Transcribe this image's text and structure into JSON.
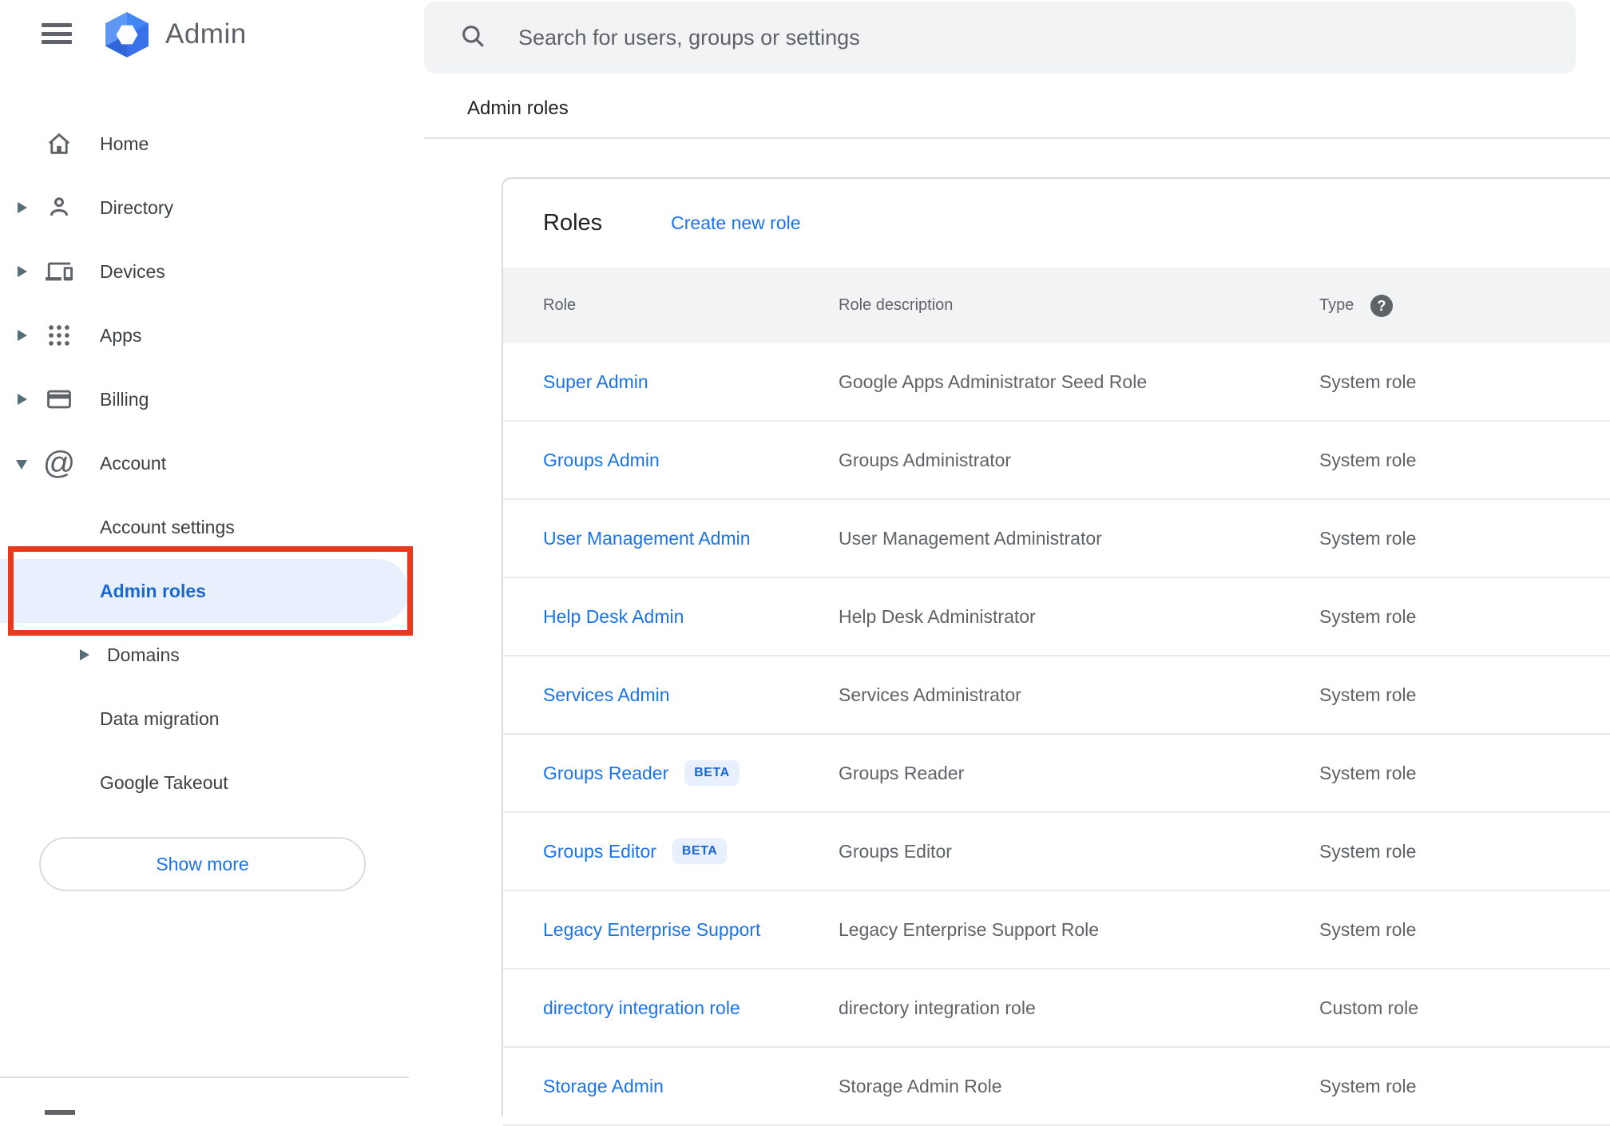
{
  "app": {
    "title": "Admin"
  },
  "search": {
    "placeholder": "Search for users, groups or settings"
  },
  "breadcrumb": "Admin roles",
  "sidebar": {
    "items": [
      {
        "label": "Home",
        "icon": "home-icon",
        "expandable": false
      },
      {
        "label": "Directory",
        "icon": "person-icon",
        "expandable": true
      },
      {
        "label": "Devices",
        "icon": "devices-icon",
        "expandable": true
      },
      {
        "label": "Apps",
        "icon": "apps-grid-icon",
        "expandable": true
      },
      {
        "label": "Billing",
        "icon": "credit-card-icon",
        "expandable": true
      },
      {
        "label": "Account",
        "icon": "at-sign-icon",
        "expandable": true,
        "expanded": true
      }
    ],
    "account_children": [
      {
        "label": "Account settings"
      },
      {
        "label": "Admin roles",
        "selected": true,
        "annotated": true
      },
      {
        "label": "Domains",
        "expandable": true
      },
      {
        "label": "Data migration"
      },
      {
        "label": "Google Takeout"
      }
    ],
    "show_more_label": "Show more"
  },
  "main": {
    "card_title": "Roles",
    "create_link": "Create new role",
    "table": {
      "columns": [
        "Role",
        "Role description",
        "Type"
      ],
      "help_icon": "?",
      "rows": [
        {
          "role": "Super Admin",
          "description": "Google Apps Administrator Seed Role",
          "type": "System role"
        },
        {
          "role": "Groups Admin",
          "description": "Groups Administrator",
          "type": "System role"
        },
        {
          "role": "User Management Admin",
          "description": "User Management Administrator",
          "type": "System role"
        },
        {
          "role": "Help Desk Admin",
          "description": "Help Desk Administrator",
          "type": "System role"
        },
        {
          "role": "Services Admin",
          "description": "Services Administrator",
          "type": "System role"
        },
        {
          "role": "Groups Reader",
          "beta_label": "BETA",
          "description": "Groups Reader",
          "type": "System role"
        },
        {
          "role": "Groups Editor",
          "beta_label": "BETA",
          "description": "Groups Editor",
          "type": "System role"
        },
        {
          "role": "Legacy Enterprise Support",
          "description": "Legacy Enterprise Support Role",
          "type": "System role"
        },
        {
          "role": "directory integration role",
          "description": "directory integration role",
          "type": "Custom role"
        },
        {
          "role": "Storage Admin",
          "description": "Storage Admin Role",
          "type": "System role"
        }
      ]
    }
  },
  "colors": {
    "accent_blue": "#1a73e8",
    "selected_blue": "#1967d2",
    "selected_pill_bg": "#e8f0fe",
    "beta_badge_bg": "#e8f0fe",
    "beta_badge_text": "#1967d2",
    "annotation_red": "#e8391d",
    "header_bg": "#f1f3f4",
    "search_bg": "#f1f3f4",
    "text_dark": "#202124",
    "text_gray": "#5f6368",
    "logo_blue": "#4285f4"
  }
}
